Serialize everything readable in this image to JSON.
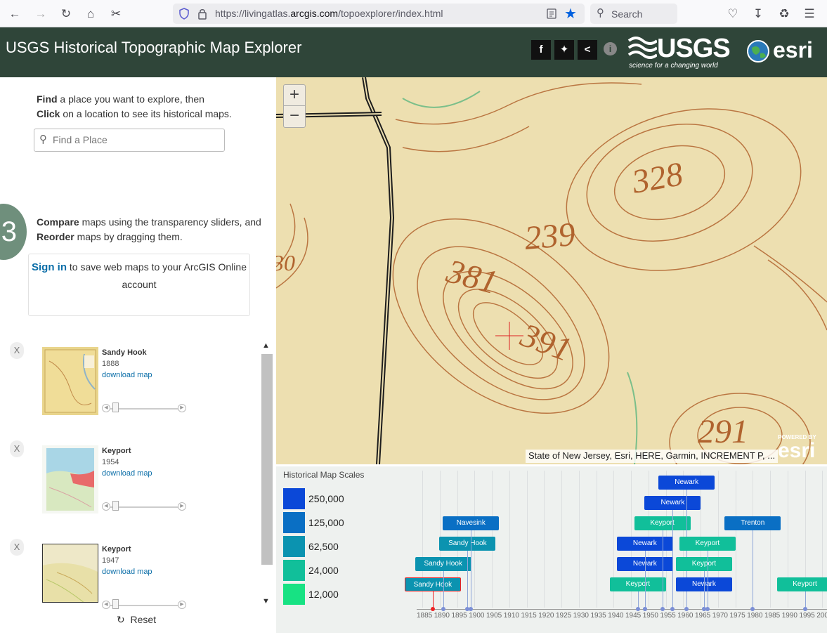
{
  "browser": {
    "url_prefix": "https://livingatlas.",
    "url_domain": "arcgis.com",
    "url_path": "/topoexplorer/index.html",
    "search_placeholder": "Search"
  },
  "header": {
    "title": "USGS Historical Topographic Map Explorer",
    "usgs_logo": "USGS",
    "usgs_tagline": "science for a changing world",
    "esri_logo": "esri",
    "share_icons": [
      "facebook-icon",
      "twitter-icon",
      "share-icon",
      "info-icon"
    ]
  },
  "sidebar": {
    "find_bold": "Find",
    "find_rest": " a place you want to explore, then",
    "click_bold": "Click",
    "click_rest": " on a location to see its historical maps.",
    "search_placeholder": "Find a Place",
    "step_number": "3",
    "compare_bold": "Compare",
    "compare_rest": " maps using the transparency sliders, and",
    "reorder_bold": "Reorder",
    "reorder_rest": " maps by dragging them.",
    "signin_link": "Sign in",
    "signin_rest": " to save web maps to your ArcGIS Online account",
    "close_label": "X",
    "download_label": "download map",
    "maps": [
      {
        "title": "Sandy Hook",
        "year": "1888"
      },
      {
        "title": "Keyport",
        "year": "1954"
      },
      {
        "title": "Keyport",
        "year": "1947"
      }
    ],
    "reset_label": "Reset"
  },
  "map": {
    "zoom_in": "+",
    "zoom_out": "−",
    "attribution": "State of New Jersey, Esri, HERE, Garmin, INCREMENT P, ...",
    "powered_by": "POWERED BY",
    "powered_logo": "esri",
    "elevation_labels": [
      "328",
      "239",
      "381",
      "391",
      "291",
      "30"
    ]
  },
  "scales": {
    "title": "Historical Map Scales",
    "items": [
      {
        "label": "250,000",
        "color": "#0b48d8"
      },
      {
        "label": "125,000",
        "color": "#0a6fc4"
      },
      {
        "label": "62,500",
        "color": "#0b93b0"
      },
      {
        "label": "24,000",
        "color": "#11bf9a"
      },
      {
        "label": "12,000",
        "color": "#17e283"
      }
    ]
  },
  "chart_data": {
    "type": "timeline",
    "x_ticks": [
      "1885",
      "1890",
      "1895",
      "1900",
      "1905",
      "1910",
      "1915",
      "1920",
      "1925",
      "1930",
      "1935",
      "1940",
      "1945",
      "1950",
      "1955",
      "1960",
      "1965",
      "1970",
      "1975",
      "1980",
      "1985",
      "1990",
      "1995",
      "200"
    ],
    "xlim": [
      1885,
      2000
    ],
    "maps": [
      {
        "name": "Sandy Hook",
        "year": 1888,
        "scale": "62,500",
        "selected": true
      },
      {
        "name": "Sandy Hook",
        "year": 1891,
        "scale": "62,500"
      },
      {
        "name": "Sandy Hook",
        "year": 1898,
        "scale": "62,500"
      },
      {
        "name": "Navesink",
        "year": 1899,
        "scale": "125,000"
      },
      {
        "name": "Keyport",
        "year": 1947,
        "scale": "24,000"
      },
      {
        "name": "Newark",
        "year": 1949,
        "scale": "250,000"
      },
      {
        "name": "Newark",
        "year": 1949,
        "scale": "250,000"
      },
      {
        "name": "Keyport",
        "year": 1954,
        "scale": "24,000"
      },
      {
        "name": "Newark",
        "year": 1957,
        "scale": "250,000"
      },
      {
        "name": "Newark",
        "year": 1961,
        "scale": "250,000"
      },
      {
        "name": "Newark",
        "year": 1966,
        "scale": "250,000"
      },
      {
        "name": "Keyport",
        "year": 1966,
        "scale": "24,000"
      },
      {
        "name": "Keyport",
        "year": 1967,
        "scale": "24,000"
      },
      {
        "name": "Trenton",
        "year": 1980,
        "scale": "125,000"
      },
      {
        "name": "Keyport",
        "year": 1995,
        "scale": "24,000"
      }
    ]
  }
}
